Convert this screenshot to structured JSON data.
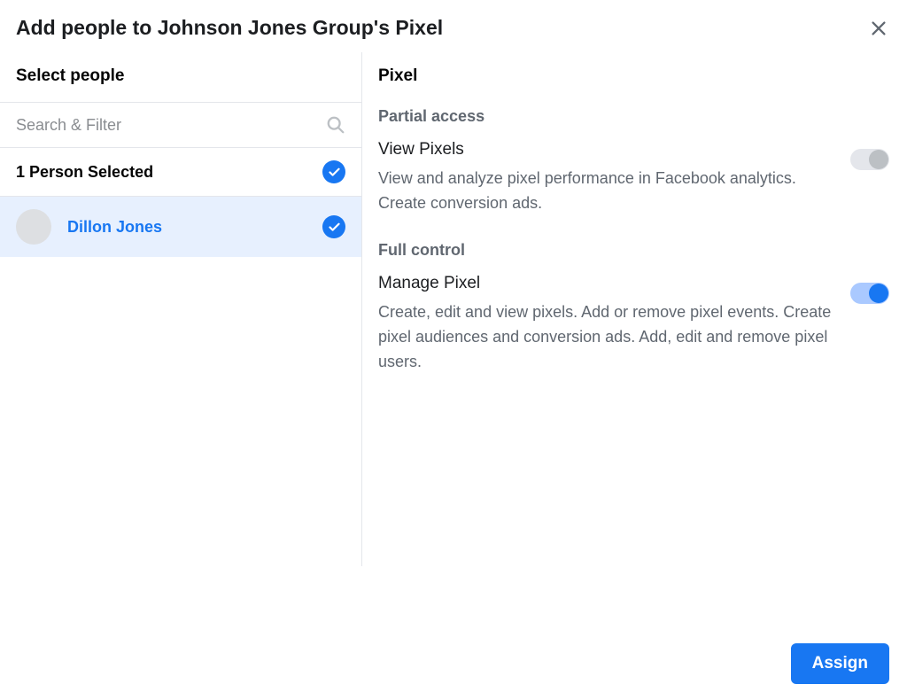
{
  "modal": {
    "title": "Add people to Johnson Jones Group's Pixel"
  },
  "left": {
    "section_title": "Select people",
    "search_placeholder": "Search & Filter",
    "selected_count_label": "1 Person Selected",
    "people": [
      {
        "name": "Dillon Jones",
        "selected": true
      }
    ]
  },
  "right": {
    "title": "Pixel",
    "groups": [
      {
        "label": "Partial access",
        "permissions": [
          {
            "title": "View Pixels",
            "description": "View and analyze pixel performance in Facebook analytics. Create conversion ads.",
            "enabled": false
          }
        ]
      },
      {
        "label": "Full control",
        "permissions": [
          {
            "title": "Manage Pixel",
            "description": "Create, edit and view pixels. Add or remove pixel events. Create pixel audiences and conversion ads. Add, edit and remove pixel users.",
            "enabled": true
          }
        ]
      }
    ]
  },
  "footer": {
    "assign_label": "Assign"
  }
}
